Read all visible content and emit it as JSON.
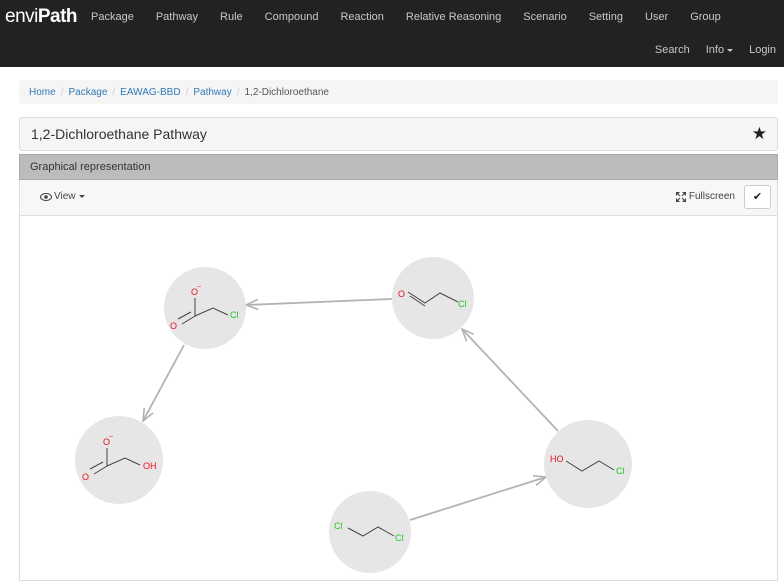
{
  "brand": {
    "part1": "envi",
    "part2": "Path"
  },
  "nav": {
    "items": [
      "Package",
      "Pathway",
      "Rule",
      "Compound",
      "Reaction",
      "Relative Reasoning",
      "Scenario",
      "Setting",
      "User",
      "Group"
    ],
    "right": {
      "search": "Search",
      "info": "Info",
      "login": "Login"
    }
  },
  "breadcrumb": {
    "home": "Home",
    "package": "Package",
    "eawag": "EAWAG-BBD",
    "pathway": "Pathway",
    "current": "1,2-Dichloroethane"
  },
  "panel": {
    "title": "1,2-Dichloroethane Pathway",
    "star_icon": "star-icon"
  },
  "graph": {
    "heading": "Graphical representation",
    "view_label": "View",
    "fullscreen_label": "Fullscreen",
    "node_color": "#e6e6e6",
    "edge_color": "#b3b3b3",
    "oxygen_color": "#e8101a",
    "chlorine_color": "#22c422",
    "labels": {
      "o_minus": "O",
      "charge": "−",
      "o": "O",
      "cl": "Cl",
      "oh": "OH",
      "ho": "HO"
    }
  }
}
